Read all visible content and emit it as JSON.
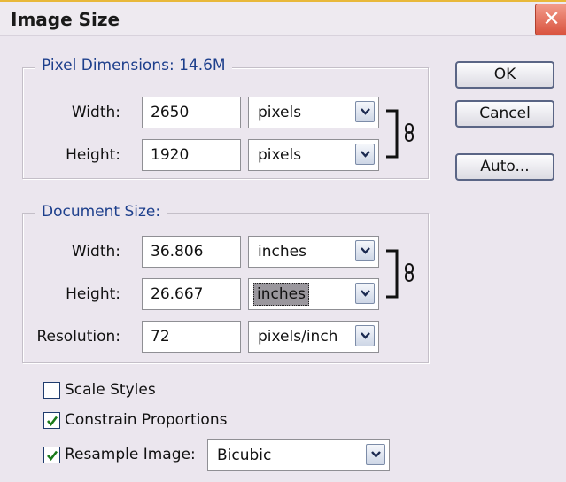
{
  "dialog": {
    "title": "Image Size",
    "close_glyph": "✕"
  },
  "pixel_dimensions": {
    "legend": "Pixel Dimensions:  14.6M",
    "width_label": "Width:",
    "width_value": "2650",
    "width_unit": "pixels",
    "height_label": "Height:",
    "height_value": "1920",
    "height_unit": "pixels"
  },
  "document_size": {
    "legend": "Document Size:",
    "width_label": "Width:",
    "width_value": "36.806",
    "width_unit": "inches",
    "height_label": "Height:",
    "height_value": "26.667",
    "height_unit": "inches",
    "resolution_label": "Resolution:",
    "resolution_value": "72",
    "resolution_unit": "pixels/inch"
  },
  "buttons": {
    "ok": "OK",
    "cancel": "Cancel",
    "auto": "Auto..."
  },
  "options": {
    "scale_styles": {
      "label": "Scale Styles",
      "checked": false
    },
    "constrain_proportions": {
      "label": "Constrain Proportions",
      "checked": true
    },
    "resample_image": {
      "label": "Resample Image:",
      "checked": true,
      "method": "Bicubic"
    }
  },
  "icons": [
    "close-icon",
    "chevron-down-icon",
    "chain-link-icon",
    "checkmark-icon"
  ],
  "colors": {
    "legend_text": "#1d3f8c",
    "close_button": "#d9533f",
    "dialog_bg": "#ebe6ee"
  }
}
